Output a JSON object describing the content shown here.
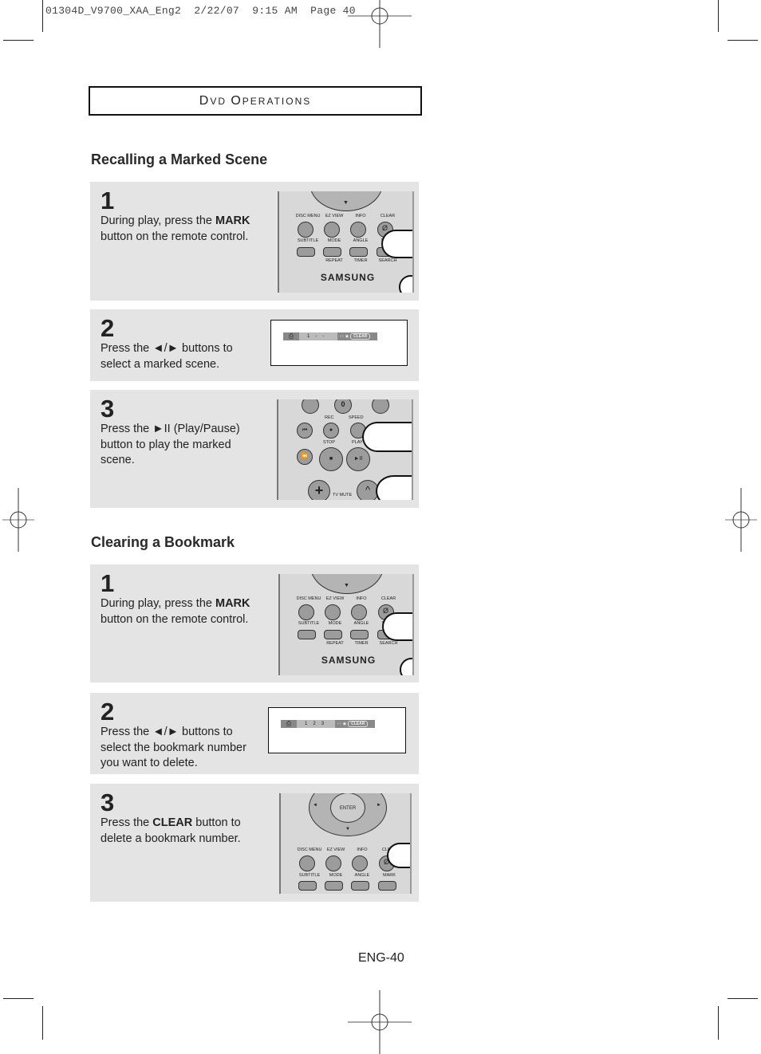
{
  "slug": "01304D_V9700_XAA_Eng2  2/22/07  9:15 AM  Page 40",
  "header": {
    "first_big": "D",
    "first_rest": "VD ",
    "second_big": "O",
    "second_rest": "PERATIONS"
  },
  "sections": [
    {
      "title": "Recalling a Marked Scene",
      "steps": [
        {
          "number": "1",
          "pre": "During play, press the ",
          "bold": "MARK",
          "post": " button on the remote control.",
          "figure": "remote-mark"
        },
        {
          "number": "2",
          "pre": "Press the ◄/► buttons to select a marked scene.",
          "bold": "",
          "post": "",
          "figure": "osd",
          "osd": {
            "slots": [
              "1",
              "-",
              "-"
            ],
            "clear_label": "CLEAR"
          }
        },
        {
          "number": "3",
          "pre": "Press the ►II (Play/Pause) button to play the marked scene.",
          "bold": "",
          "post": "",
          "figure": "remote-play"
        }
      ]
    },
    {
      "title": "Clearing a Bookmark",
      "steps": [
        {
          "number": "1",
          "pre": "During play, press the ",
          "bold": "MARK",
          "post": " button on the remote control.",
          "figure": "remote-mark"
        },
        {
          "number": "2",
          "pre": "Press the ◄/► buttons to select the bookmark number you want to delete.",
          "bold": "",
          "post": "",
          "figure": "osd",
          "osd": {
            "slots": [
              "1",
              "2",
              "3"
            ],
            "clear_label": "CLEAR"
          }
        },
        {
          "number": "3",
          "pre": "Press the ",
          "bold": "CLEAR",
          "post": " button to delete a bookmark number.",
          "figure": "remote-clear"
        }
      ]
    }
  ],
  "remote_labels": {
    "row1": [
      "DISC MENU",
      "EZ VIEW",
      "INFO",
      "CLEAR"
    ],
    "row2": [
      "SUBTITLE",
      "MODE",
      "ANGLE",
      "MARK"
    ],
    "row3": [
      "REPEAT",
      "TIMER",
      "SEARCH"
    ],
    "brand": "SAMSUNG",
    "play_labels": [
      "REC",
      "SPEED",
      "STOP",
      "PLAY",
      "TV MUTE"
    ],
    "zero": "0",
    "enter": "ENTER"
  },
  "page_number": "ENG-40"
}
